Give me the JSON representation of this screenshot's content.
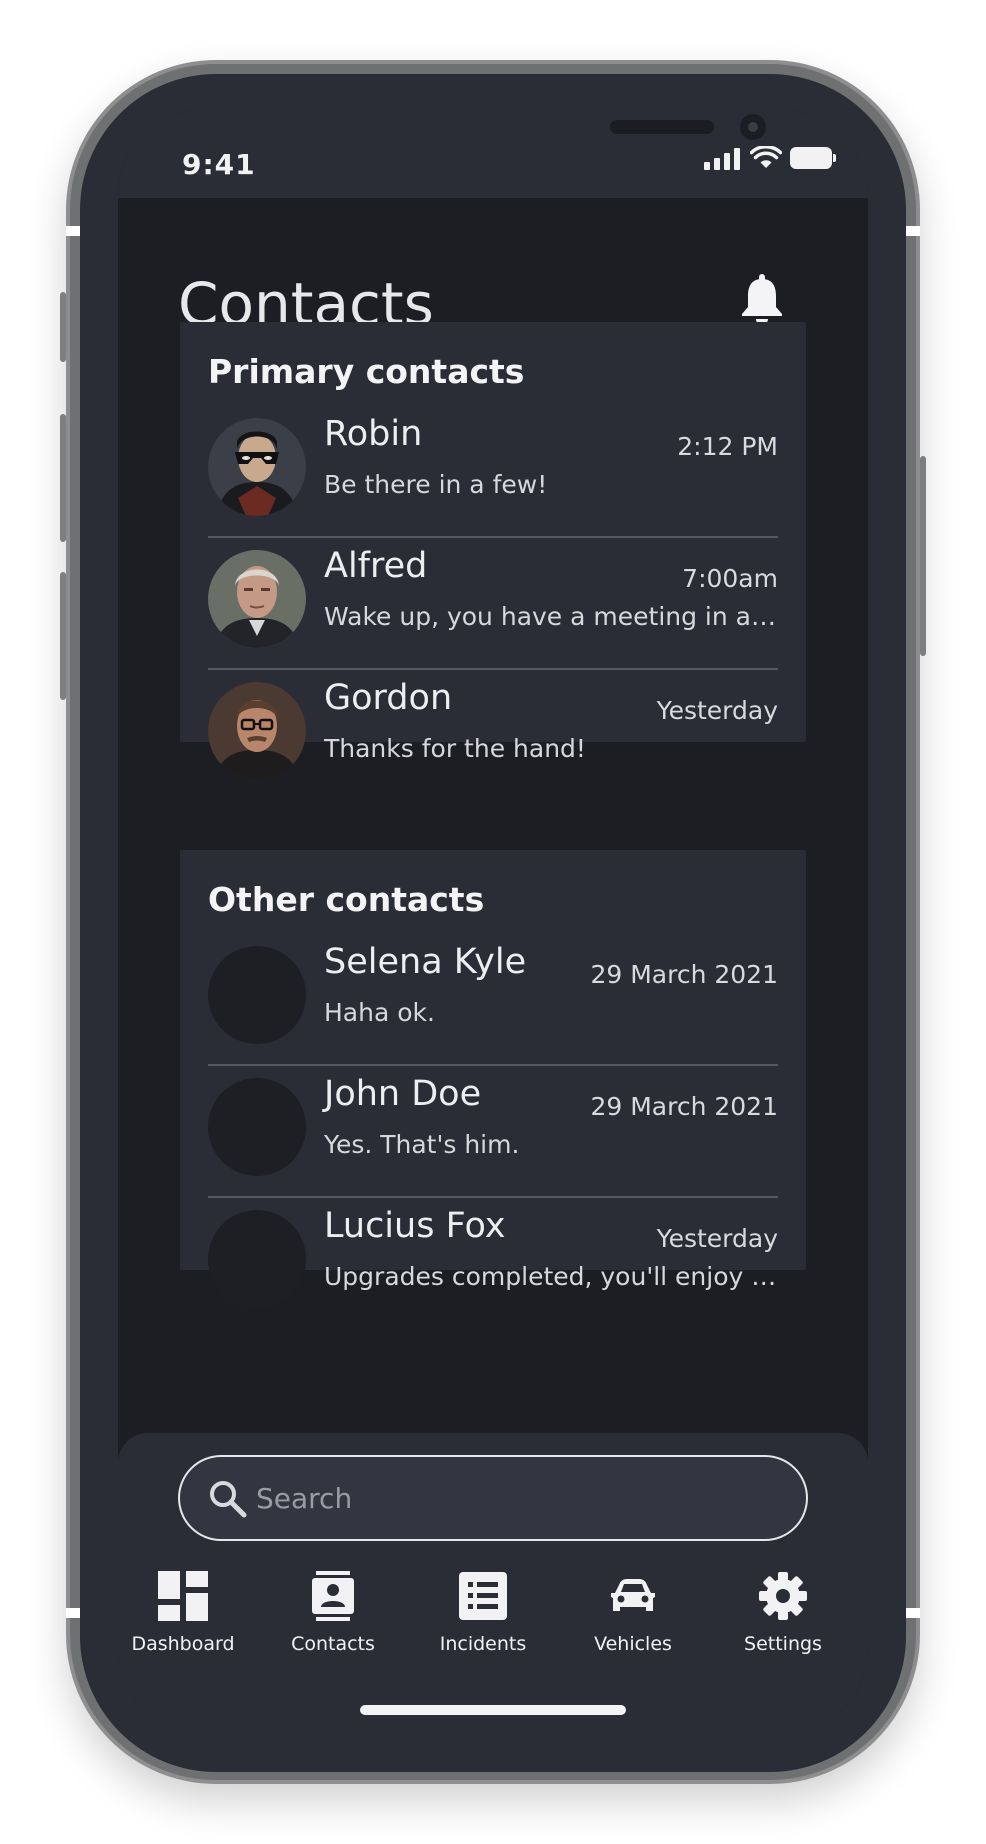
{
  "status_bar": {
    "time": "9:41"
  },
  "header": {
    "title": "Contacts"
  },
  "primary": {
    "title": "Primary contacts",
    "contacts": [
      {
        "name": "Robin",
        "time": "2:12 PM",
        "message": "Be there in a few!"
      },
      {
        "name": "Alfred",
        "time": "7:00am",
        "message": "Wake up, you have a meeting in an hour."
      },
      {
        "name": "Gordon",
        "time": "Yesterday",
        "message": "Thanks for the hand!"
      }
    ]
  },
  "other": {
    "title": "Other contacts",
    "contacts": [
      {
        "name": "Selena Kyle",
        "time": "29 March 2021",
        "message": "Haha ok."
      },
      {
        "name": "John Doe",
        "time": "29 March 2021",
        "message": "Yes. That's him."
      },
      {
        "name": "Lucius Fox",
        "time": "Yesterday",
        "message": "Upgrades completed, you'll enjoy the ride."
      }
    ]
  },
  "search": {
    "placeholder": "Search"
  },
  "nav": {
    "items": [
      {
        "label": "Dashboard",
        "icon": "dashboard-icon"
      },
      {
        "label": "Contacts",
        "icon": "contacts-icon"
      },
      {
        "label": "Incidents",
        "icon": "incidents-icon"
      },
      {
        "label": "Vehicles",
        "icon": "vehicles-icon"
      },
      {
        "label": "Settings",
        "icon": "settings-icon"
      }
    ]
  },
  "colors": {
    "background": "#1c1e24",
    "card": "#2a2d35",
    "text": "#eceef0",
    "divider": "#55585f"
  }
}
